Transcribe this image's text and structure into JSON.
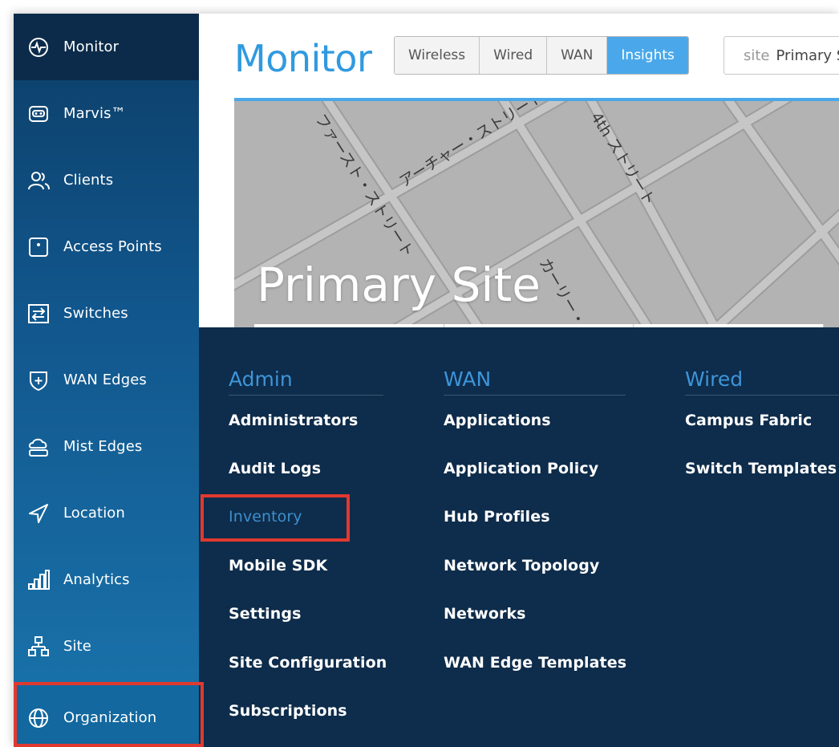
{
  "sidebar": {
    "items": [
      {
        "label": "Monitor",
        "icon": "monitor-pulse-icon"
      },
      {
        "label": "Marvis™",
        "icon": "marvis-icon"
      },
      {
        "label": "Clients",
        "icon": "clients-icon"
      },
      {
        "label": "Access Points",
        "icon": "access-point-icon"
      },
      {
        "label": "Switches",
        "icon": "switch-icon"
      },
      {
        "label": "WAN Edges",
        "icon": "wan-edge-shield-icon"
      },
      {
        "label": "Mist Edges",
        "icon": "cloud-icon"
      },
      {
        "label": "Location",
        "icon": "location-arrow-icon"
      },
      {
        "label": "Analytics",
        "icon": "analytics-bars-icon"
      },
      {
        "label": "Site",
        "icon": "site-tree-icon"
      },
      {
        "label": "Organization",
        "icon": "globe-icon"
      }
    ]
  },
  "header": {
    "title": "Monitor",
    "tabs": [
      "Wireless",
      "Wired",
      "WAN",
      "Insights"
    ],
    "active_tab": "Insights",
    "site_prefix": "site",
    "site_value": "Primary Site"
  },
  "map": {
    "site_name": "Primary Site",
    "street_labels": [
      "ファースト・ストリート",
      "アーチャー・ストリート",
      "4th ストリート",
      "カーリー・ストリート"
    ]
  },
  "org_menu": {
    "columns": [
      {
        "heading": "Admin",
        "items": [
          "Administrators",
          "Audit Logs",
          "Inventory",
          "Mobile SDK",
          "Settings",
          "Site Configuration",
          "Subscriptions"
        ]
      },
      {
        "heading": "WAN",
        "items": [
          "Applications",
          "Application Policy",
          "Hub Profiles",
          "Network Topology",
          "Networks",
          "WAN Edge Templates"
        ]
      },
      {
        "heading": "Wired",
        "items": [
          "Campus Fabric",
          "Switch Templates"
        ]
      }
    ],
    "highlighted_item": "Inventory"
  },
  "colors": {
    "accent": "#2f9ae0",
    "active_tab": "#4aa8ea",
    "menu_bg": "#0e2c4b",
    "highlight": "#e0392f"
  }
}
